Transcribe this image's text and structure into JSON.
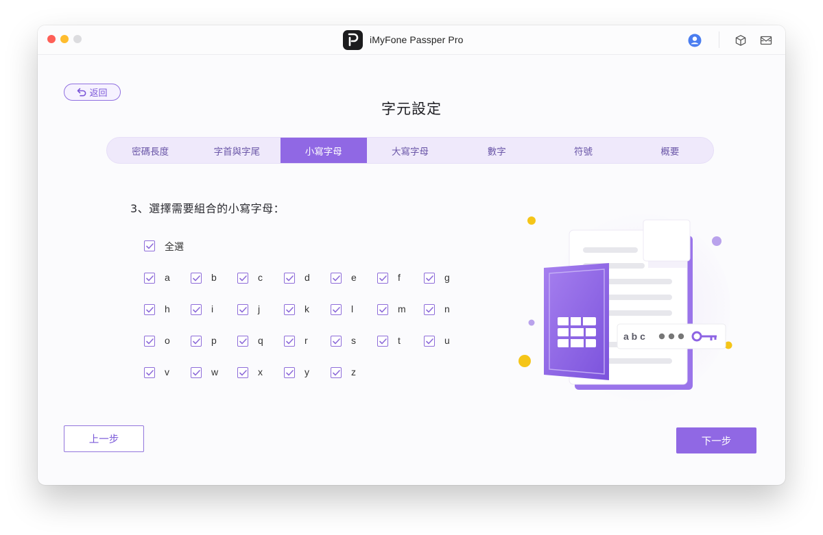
{
  "window": {
    "title": "iMyFone Passper Pro"
  },
  "nav": {
    "back_label": "返回"
  },
  "page": {
    "title": "字元設定"
  },
  "tabs": [
    {
      "label": "密碼長度",
      "active": false
    },
    {
      "label": "字首與字尾",
      "active": false
    },
    {
      "label": "小寫字母",
      "active": true
    },
    {
      "label": "大寫字母",
      "active": false
    },
    {
      "label": "數字",
      "active": false
    },
    {
      "label": "符號",
      "active": false
    },
    {
      "label": "概要",
      "active": false
    }
  ],
  "section": {
    "label": "3、選擇需要組合的小寫字母："
  },
  "select_all": {
    "label": "全選",
    "checked": true
  },
  "letters": [
    {
      "label": "a",
      "checked": true
    },
    {
      "label": "b",
      "checked": true
    },
    {
      "label": "c",
      "checked": true
    },
    {
      "label": "d",
      "checked": true
    },
    {
      "label": "e",
      "checked": true
    },
    {
      "label": "f",
      "checked": true
    },
    {
      "label": "g",
      "checked": true
    },
    {
      "label": "h",
      "checked": true
    },
    {
      "label": "i",
      "checked": true
    },
    {
      "label": "j",
      "checked": true
    },
    {
      "label": "k",
      "checked": true
    },
    {
      "label": "l",
      "checked": true
    },
    {
      "label": "m",
      "checked": true
    },
    {
      "label": "n",
      "checked": true
    },
    {
      "label": "o",
      "checked": true
    },
    {
      "label": "p",
      "checked": true
    },
    {
      "label": "q",
      "checked": true
    },
    {
      "label": "r",
      "checked": true
    },
    {
      "label": "s",
      "checked": true
    },
    {
      "label": "t",
      "checked": true
    },
    {
      "label": "u",
      "checked": true
    },
    {
      "label": "v",
      "checked": true
    },
    {
      "label": "w",
      "checked": true
    },
    {
      "label": "x",
      "checked": true
    },
    {
      "label": "y",
      "checked": true
    },
    {
      "label": "z",
      "checked": true
    }
  ],
  "illustration": {
    "password_text": "a b c"
  },
  "footer": {
    "prev_label": "上一步",
    "next_label": "下一步"
  },
  "colors": {
    "accent": "#9068e4",
    "accent_light": "#efe9fb",
    "close": "#fe5f57",
    "minimize": "#febc2e",
    "yellow_dot": "#f5c518"
  },
  "icons": {
    "user": "user-circle-icon",
    "box": "cube-icon",
    "mail": "mail-icon",
    "back": "undo-arrow-icon",
    "check": "checkmark-icon"
  }
}
